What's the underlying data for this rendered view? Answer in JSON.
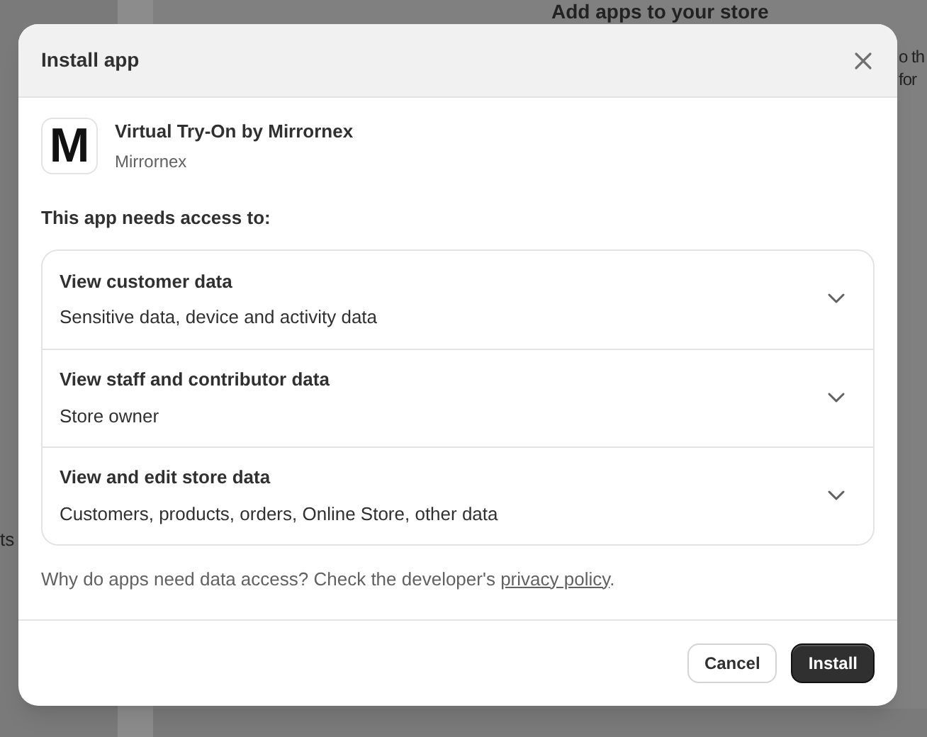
{
  "background": {
    "heading": "Add apps to your store",
    "side_lines": [
      "o th",
      "for"
    ],
    "left_text": "ts"
  },
  "dialog": {
    "title": "Install app",
    "app": {
      "name": "Virtual Try-On by Mirrornex",
      "developer": "Mirrornex",
      "logo_letter": "M"
    },
    "access_heading": "This app needs access to:",
    "permissions": [
      {
        "title": "View customer data",
        "detail": "Sensitive data, device and activity data",
        "expanded": false
      },
      {
        "title": "View staff and contributor data",
        "detail": "Store owner",
        "expanded": false
      },
      {
        "title": "View and edit store data",
        "detail": "Customers, products, orders, Online Store, other data",
        "expanded": false
      }
    ],
    "note": "Why do apps need data access? Check the developer's ",
    "link": "privacy policy",
    "note_end": ".",
    "buttons": [
      {
        "label": "Cancel",
        "kind": "secondary"
      },
      {
        "label": "Install",
        "kind": "primary"
      }
    ]
  }
}
